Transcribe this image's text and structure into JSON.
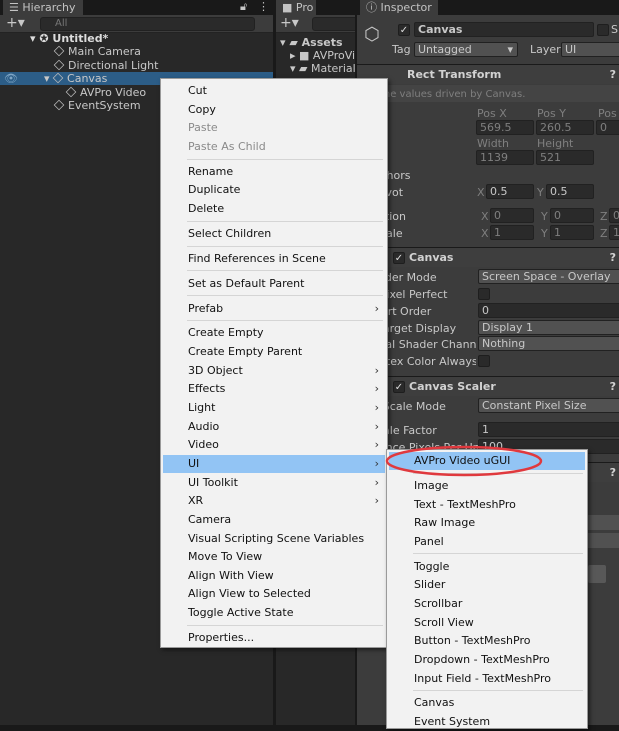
{
  "hierarchy": {
    "tab": "Hierarchy",
    "search_placeholder": "All",
    "scene": "Untitled*",
    "items": [
      {
        "label": "Main Camera",
        "depth": 1
      },
      {
        "label": "Directional Light",
        "depth": 1
      },
      {
        "label": "Canvas",
        "depth": 1,
        "selected": true
      },
      {
        "label": "AVPro Video",
        "depth": 2
      },
      {
        "label": "EventSystem",
        "depth": 1
      }
    ]
  },
  "project": {
    "tab": "Pro",
    "items": [
      "Assets",
      "AVProVid",
      "Material"
    ]
  },
  "inspector": {
    "tab": "Inspector",
    "object_name": "Canvas",
    "active": true,
    "static_label": "S",
    "tag_label": "Tag",
    "tag_value": "Untagged",
    "layer_label": "Layer",
    "layer_value": "UI",
    "rect_transform": {
      "title": "Rect Transform",
      "note": "Some values driven by Canvas.",
      "pos_x_label": "Pos X",
      "pos_y_label": "Pos Y",
      "pos_z_label": "Pos",
      "pos_x": "569.5",
      "pos_y": "260.5",
      "pos_z": "0",
      "width_label": "Width",
      "height_label": "Height",
      "width": "1139",
      "height": "521",
      "anchors": "Anchors",
      "pivot": "Pivot",
      "pivot_x": "0.5",
      "pivot_y": "0.5",
      "rotation": "Rotation",
      "rot_x": "0",
      "rot_y": "0",
      "rot_z": "0",
      "scale": "Scale",
      "scale_x": "1",
      "scale_y": "1",
      "scale_z": "1"
    },
    "canvas": {
      "title": "Canvas",
      "render_mode_label": "Render Mode",
      "render_mode": "Screen Space - Overlay",
      "pixel_perfect": "Pixel Perfect",
      "sort_order_label": "Sort Order",
      "sort_order": "0",
      "target_display_label": "Target Display",
      "target_display": "Display 1",
      "shader_channels_label": "Additional Shader Channels",
      "shader_channels": "Nothing",
      "vertex_color_label": "Vertex Color Always In Gamma"
    },
    "canvas_scaler": {
      "title": "Canvas Scaler",
      "scale_mode_label": "UI Scale Mode",
      "scale_mode": "Constant Pixel Size",
      "scale_factor_label": "Scale Factor",
      "scale_factor": "1",
      "ref_ppu_label": "Reference Pixels Per Unit",
      "ref_ppu": "100"
    }
  },
  "context_menu": [
    {
      "label": "Cut"
    },
    {
      "label": "Copy"
    },
    {
      "label": "Paste",
      "disabled": true
    },
    {
      "label": "Paste As Child",
      "disabled": true
    },
    {
      "sep": true
    },
    {
      "label": "Rename"
    },
    {
      "label": "Duplicate"
    },
    {
      "label": "Delete"
    },
    {
      "sep": true
    },
    {
      "label": "Select Children"
    },
    {
      "sep": true
    },
    {
      "label": "Find References in Scene"
    },
    {
      "sep": true
    },
    {
      "label": "Set as Default Parent"
    },
    {
      "sep": true
    },
    {
      "label": "Prefab",
      "submenu": true
    },
    {
      "sep": true
    },
    {
      "label": "Create Empty"
    },
    {
      "label": "Create Empty Parent"
    },
    {
      "label": "3D Object",
      "submenu": true
    },
    {
      "label": "Effects",
      "submenu": true
    },
    {
      "label": "Light",
      "submenu": true
    },
    {
      "label": "Audio",
      "submenu": true
    },
    {
      "label": "Video",
      "submenu": true
    },
    {
      "label": "UI",
      "submenu": true,
      "highlighted": true
    },
    {
      "label": "UI Toolkit",
      "submenu": true
    },
    {
      "label": "XR",
      "submenu": true
    },
    {
      "label": "Camera"
    },
    {
      "label": "Visual Scripting Scene Variables"
    },
    {
      "label": "Move To View"
    },
    {
      "label": "Align With View"
    },
    {
      "label": "Align View to Selected"
    },
    {
      "label": "Toggle Active State"
    },
    {
      "sep": true
    },
    {
      "label": "Properties..."
    }
  ],
  "ui_submenu": [
    {
      "label": "AVPro Video uGUI",
      "highlighted": true,
      "circled": true
    },
    {
      "sep": true
    },
    {
      "label": "Image"
    },
    {
      "label": "Text - TextMeshPro"
    },
    {
      "label": "Raw Image"
    },
    {
      "label": "Panel"
    },
    {
      "sep": true
    },
    {
      "label": "Toggle"
    },
    {
      "label": "Slider"
    },
    {
      "label": "Scrollbar"
    },
    {
      "label": "Scroll View"
    },
    {
      "label": "Button - TextMeshPro"
    },
    {
      "label": "Dropdown - TextMeshPro"
    },
    {
      "label": "Input Field - TextMeshPro"
    },
    {
      "sep": true
    },
    {
      "label": "Canvas"
    },
    {
      "label": "Event System"
    }
  ],
  "colors": {
    "highlight": "#92c4f4",
    "selection": "#2c5d87",
    "annotation": "#e0393e"
  }
}
